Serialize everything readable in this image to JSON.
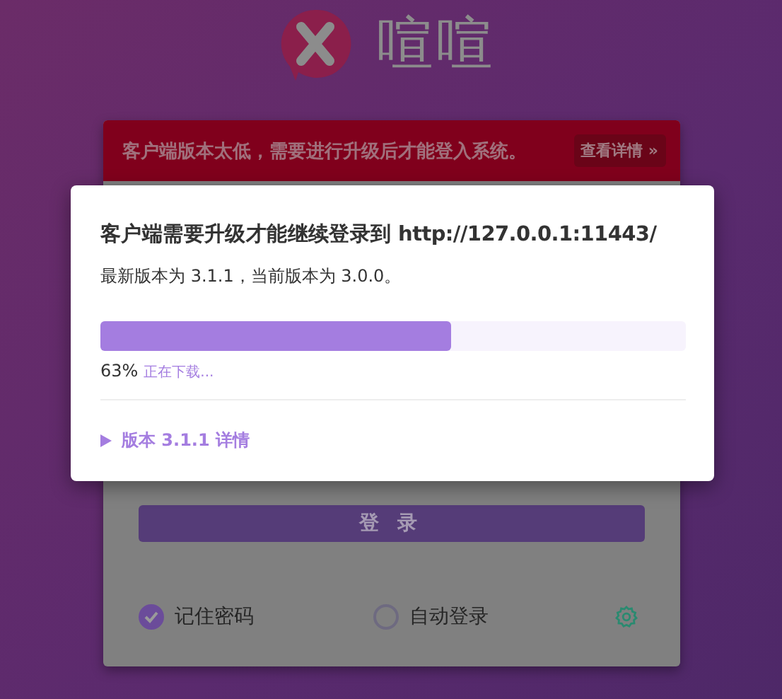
{
  "logo": {
    "text": "喧喧"
  },
  "banner": {
    "message": "客户端版本太低，需要进行升级后才能登入系统。",
    "link": "查看详情 »"
  },
  "login_button": "登 录",
  "options": [
    {
      "label": "记住密码",
      "kind": "checkbox",
      "checked": true
    },
    {
      "label": "自动登录",
      "kind": "radio",
      "checked": false
    }
  ],
  "dialog": {
    "title": "客户端需要升级才能继续登录到 http://127.0.0.1:11443/",
    "subtitle": "最新版本为 3.1.1，当前版本为 3.0.0。",
    "progress": {
      "level": 0.6,
      "percent": "63%",
      "status": "正在下载..."
    },
    "details": {
      "label": "版本 3.1.1 详情",
      "expanded": false
    }
  }
}
